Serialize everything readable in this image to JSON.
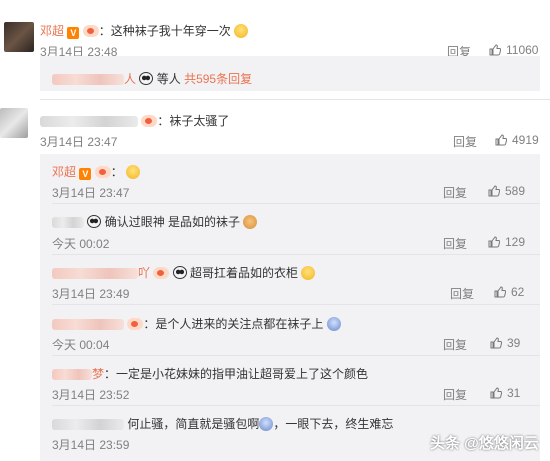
{
  "comments": [
    {
      "name": "邓超",
      "text": "：这种袜子我十年穿一次",
      "time": "3月14日 23:48",
      "reply": "回复",
      "likes": "11060"
    },
    {
      "name_suffix": "人",
      "text": "等人",
      "count_link": "共595条回复"
    },
    {
      "text": "：袜子太骚了",
      "time": "3月14日 23:47",
      "reply": "回复",
      "likes": "4919"
    }
  ],
  "replies": [
    {
      "name": "邓超",
      "text": "：",
      "time": "3月14日 23:47",
      "reply": "回复",
      "likes": "589"
    },
    {
      "text": "确认过眼神 是品如的袜子",
      "time": "今天 00:02",
      "reply": "回复",
      "likes": "129"
    },
    {
      "name_suffix": "吖",
      "text": "超哥扛着品如的衣柜",
      "time": "3月14日 23:49",
      "reply": "回复",
      "likes": "62"
    },
    {
      "text": "：是个人进来的关注点都在袜子上",
      "time": "今天 00:04",
      "reply": "回复",
      "likes": "39"
    },
    {
      "name_suffix": "梦",
      "text": "：一定是小花妹妹的指甲油让超哥爱上了这个颜色",
      "time": "3月14日 23:52",
      "reply": "回复",
      "likes": "31"
    },
    {
      "text": "何止骚，简直就是骚包啊",
      "text2": "，一眼下去，终生难忘",
      "time": "3月14日 23:59"
    }
  ],
  "watermark": "头条 @悠悠闲云",
  "icons": {
    "thumb": "thumbs-up-icon",
    "verified": "verified-v-icon",
    "fan": "fan-badge-icon"
  }
}
